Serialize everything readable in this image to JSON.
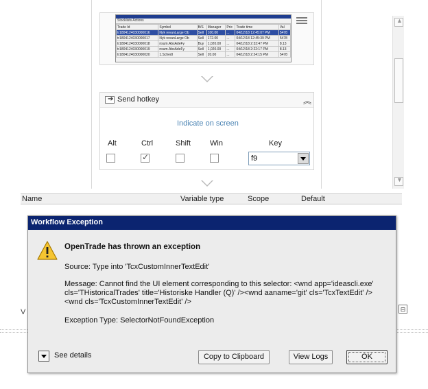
{
  "thumbnail": {
    "menu": "Stocklists   Actions",
    "headers": [
      "Trade Id",
      "Symbol",
      "B/S",
      "Manager",
      "Pric",
      "Trade time",
      "Val"
    ],
    "rows": [
      [
        "tr1804124030000016",
        "Nyk revanLarge Ob",
        "Sell",
        "100.00",
        "...",
        "04/12/18 12:45:07 PM",
        "5478"
      ],
      [
        "tr1804124030000017",
        "Nyk revanLarge Ob",
        "Sell",
        "172.00",
        "...",
        "04/12/18 12:45:39 PM",
        "5478"
      ],
      [
        "tr1804124030000018",
        "nsum.AbsAdeFy",
        "Buy",
        "1,020.00",
        "...",
        "04/12/18 2:33:47 PM",
        "8.13"
      ],
      [
        "tr1804124030000019",
        "nsum.AbsAdeFy",
        "Sell",
        "1,020.00",
        "...",
        "04/12/18 2:22:17 PM",
        "8.13"
      ],
      [
        "tr1804124030000020",
        "1.Schedl",
        "Sell",
        "20.00",
        "...",
        "04/12/18 2:24:15 PM",
        "5478"
      ]
    ]
  },
  "hotkey": {
    "title": "Send hotkey",
    "indicate": "Indicate on screen",
    "modifiers": {
      "alt": "Alt",
      "ctrl": "Ctrl",
      "shift": "Shift",
      "win": "Win"
    },
    "key_label": "Key",
    "key_value": "f9",
    "ctrl_checked": true
  },
  "variables": {
    "name": "Name",
    "type": "Variable type",
    "scope": "Scope",
    "default": "Default"
  },
  "side_letter": "V",
  "dialog": {
    "title": "Workflow Exception",
    "heading": "OpenTrade has thrown an exception",
    "source": "Source: Type into 'TcxCustomInnerTextEdit'",
    "message": "Message: Cannot find the UI element corresponding to this selector: <wnd app='ideascli.exe' cls='THistoricalTrades' title='Historiske Handler     (Q)' /><wnd aaname='git' cls='TcxTextEdit' /><wnd cls='TcxCustomInnerTextEdit' />",
    "exception_type": "Exception Type: SelectorNotFoundException",
    "see_details": "See details",
    "copy_btn": "Copy to Clipboard",
    "view_logs_btn": "View Logs",
    "ok_btn": "OK"
  },
  "icons": {
    "warning": "warning-icon",
    "hotkey": "keyboard-send-icon",
    "collapse": "chevron-up-double-icon",
    "menu": "hamburger-menu-icon",
    "expand_details": "chevron-down-icon"
  },
  "colors": {
    "dialog_title_bg": "#0b2470",
    "link": "#4a83b3"
  }
}
